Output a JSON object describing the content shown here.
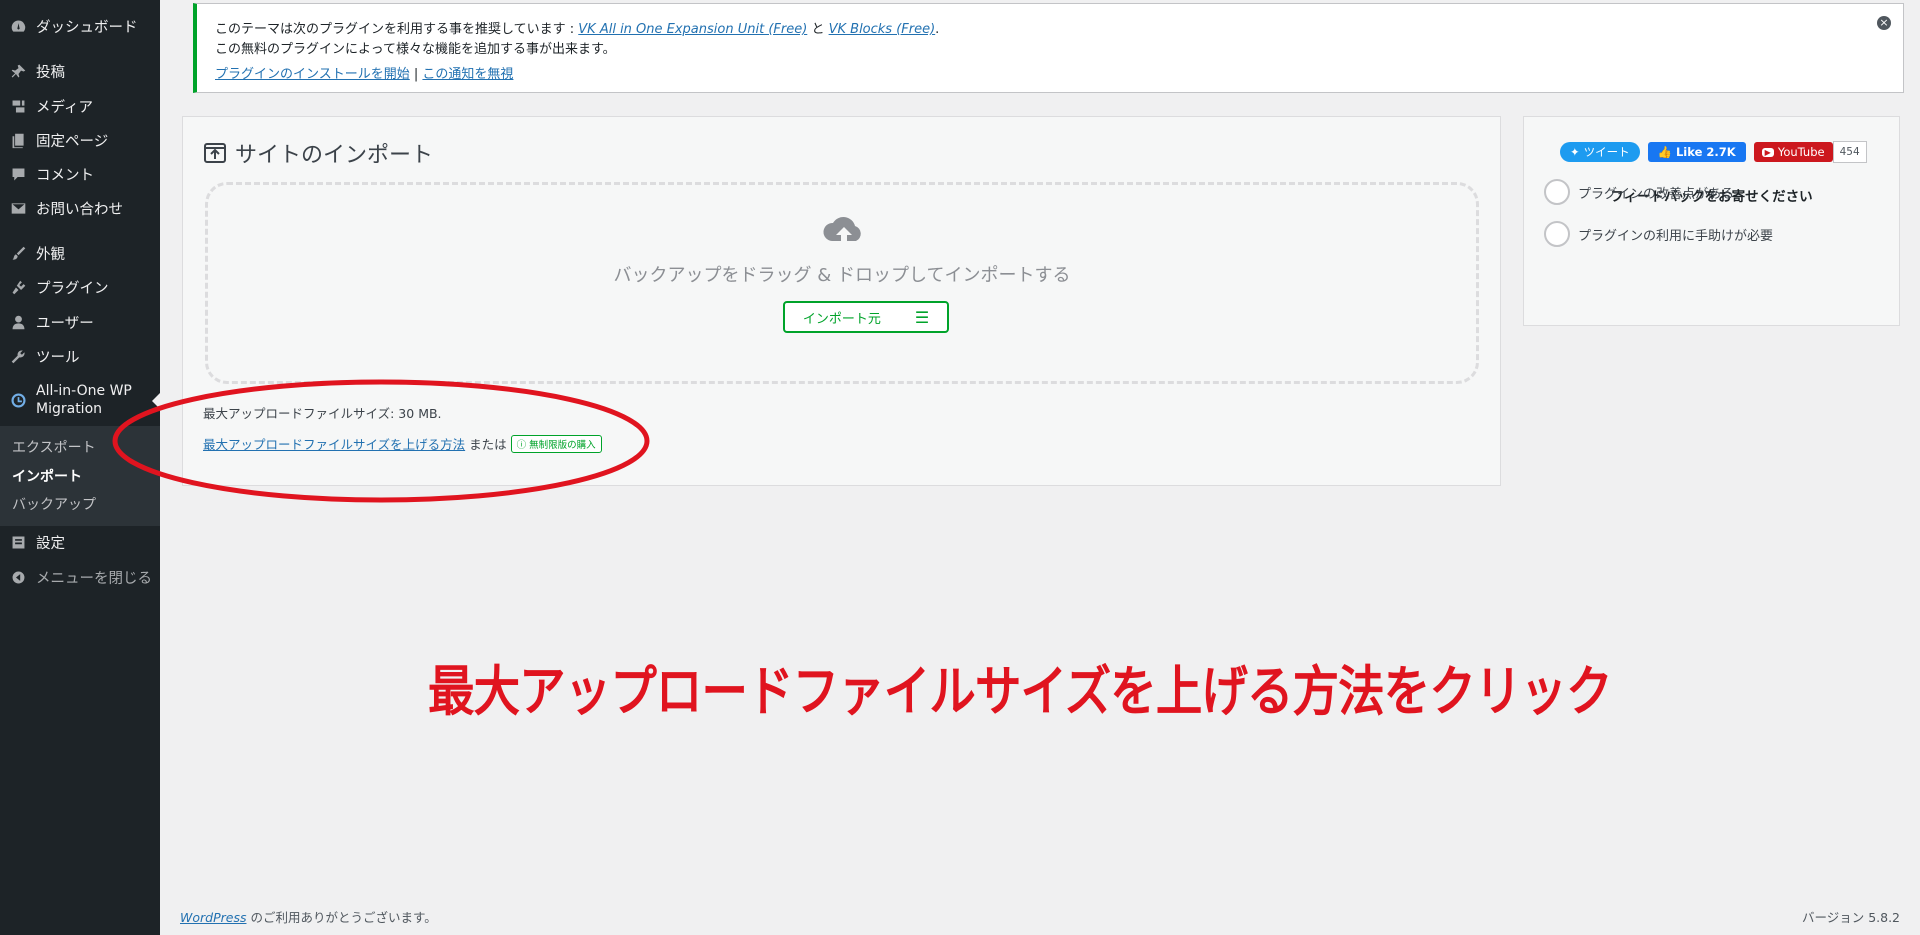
{
  "sidebar": {
    "items": [
      {
        "label": "ダッシュボード",
        "icon": "dashboard-icon"
      },
      {
        "label": "投稿",
        "icon": "pin-icon"
      },
      {
        "label": "メディア",
        "icon": "media-icon"
      },
      {
        "label": "固定ページ",
        "icon": "page-icon"
      },
      {
        "label": "コメント",
        "icon": "comment-icon"
      },
      {
        "label": "お問い合わせ",
        "icon": "mail-icon"
      },
      {
        "label": "外観",
        "icon": "brush-icon"
      },
      {
        "label": "プラグイン",
        "icon": "plugin-icon"
      },
      {
        "label": "ユーザー",
        "icon": "user-icon"
      },
      {
        "label": "ツール",
        "icon": "wrench-icon"
      }
    ],
    "active": {
      "line1": "All-in-One WP",
      "line2": "Migration",
      "icon": "aio-icon"
    },
    "submenu": [
      "エクスポート",
      "インポート",
      "バックアップ"
    ],
    "settings": "設定",
    "collapse": "メニューを閉じる"
  },
  "notice": {
    "line1_prefix": "このテーマは次のプラグインを利用する事を推奨しています :",
    "link1": "VK All in One Expansion Unit (Free)",
    "and": "と",
    "link2": "VK Blocks (Free)",
    "period": ".",
    "line2": "この無料のプラグインによって様々な機能を追加する事が出来ます。",
    "install_link": "プラグインのインストールを開始",
    "separator": "|",
    "dismiss_link": "この通知を無視"
  },
  "import": {
    "title": "サイトのインポート",
    "drop_text": "バックアップをドラッグ & ドロップしてインポートする",
    "import_from": "インポート元",
    "max_size": "最大アップロードファイルサイズ: 30 MB.",
    "howto_link": "最大アップロードファイルサイズを上げる方法",
    "or": "または",
    "unlimited": "無制限版の購入"
  },
  "feedback": {
    "tweet": "ツイート",
    "like": "Like 2.7K",
    "youtube": "YouTube",
    "youtube_count": "454",
    "title": "フィードバックをお寄せください",
    "options": [
      "プラグインの改善点がある",
      "プラグインの利用に手助けが必要"
    ]
  },
  "annotation": "最大アップロードファイルサイズを上げる方法をクリック",
  "footer": {
    "wp_link": "WordPress",
    "thanks": "のご利用ありがとうございます。",
    "version": "バージョン 5.8.2"
  },
  "colors": {
    "accent_green": "#00a32a",
    "annotation_red": "#e0141f",
    "sidebar_bg": "#1d2327",
    "link": "#2271b1"
  }
}
